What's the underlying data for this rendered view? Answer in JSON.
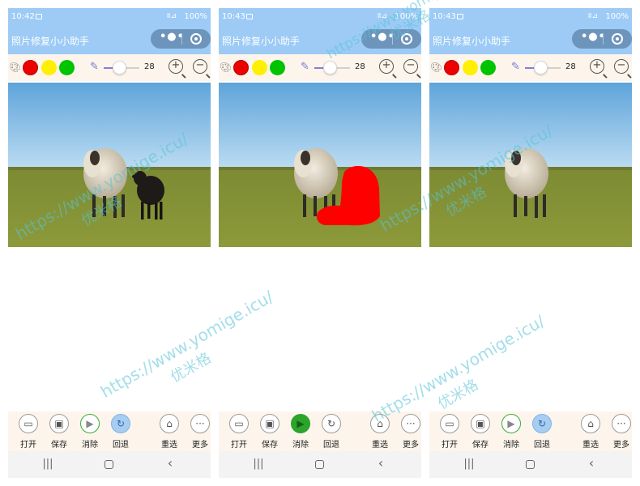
{
  "app_title": "照片修复小小助手",
  "status": {
    "battery": "100%",
    "signal": "ʬ⊿"
  },
  "capsule": {
    "more_icon": "•●•",
    "close_icon": "target-icon"
  },
  "toolbar": {
    "palette_icon": "palette-icon",
    "colors": [
      "#ec0000",
      "#ffef00",
      "#00c400"
    ],
    "pen_icon": "pen-icon",
    "brush_size": "28",
    "zoom_in": "+",
    "zoom_out": "−"
  },
  "buttons": {
    "open": "打开",
    "save": "保存",
    "erase": "消除",
    "undo": "回退",
    "reselect": "重选",
    "more": "更多"
  },
  "nav": {
    "recent": "|||",
    "back": "‹"
  },
  "phones": [
    {
      "time": "10:42",
      "erase_state": "idle",
      "undo_state": "active"
    },
    {
      "time": "10:43",
      "erase_state": "active",
      "undo_state": "idle"
    },
    {
      "time": "10:43",
      "erase_state": "idle",
      "undo_state": "active"
    }
  ],
  "watermark": {
    "url": "https://www.yomige.icu/",
    "name": "优米格"
  }
}
